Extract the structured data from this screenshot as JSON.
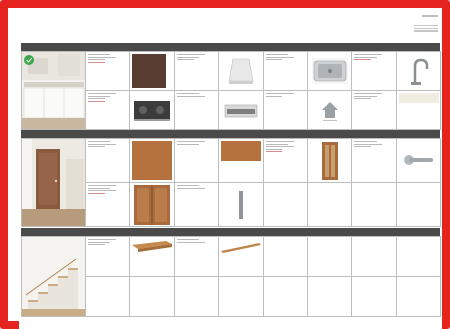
{
  "document": {
    "header": {
      "title": ""
    },
    "sections": [
      {
        "band_label": "",
        "room_photo": "kitchen-photo",
        "rows": [
          [
            "",
            "",
            "",
            "",
            "",
            "",
            "",
            ""
          ],
          [
            "",
            "",
            "",
            "",
            "",
            "",
            "",
            ""
          ]
        ]
      },
      {
        "band_label": "",
        "room_photo": "hallway-door-photo",
        "rows": [
          [
            "",
            "",
            "",
            "",
            "",
            "",
            "",
            ""
          ],
          [
            "",
            "",
            "",
            "",
            "",
            "",
            "",
            ""
          ]
        ]
      },
      {
        "band_label": "",
        "room_photo": "staircase-photo",
        "rows": [
          [
            "",
            "",
            "",
            "",
            "",
            "",
            "",
            ""
          ],
          [
            "",
            "",
            "",
            "",
            "",
            "",
            "",
            ""
          ]
        ]
      }
    ]
  },
  "colors": {
    "frame": "#e5231f",
    "band": "#4a4a4a",
    "wood": "#b5723e",
    "dark_wood": "#5a3d32"
  },
  "icons": [
    "check-icon",
    "home-icon"
  ]
}
